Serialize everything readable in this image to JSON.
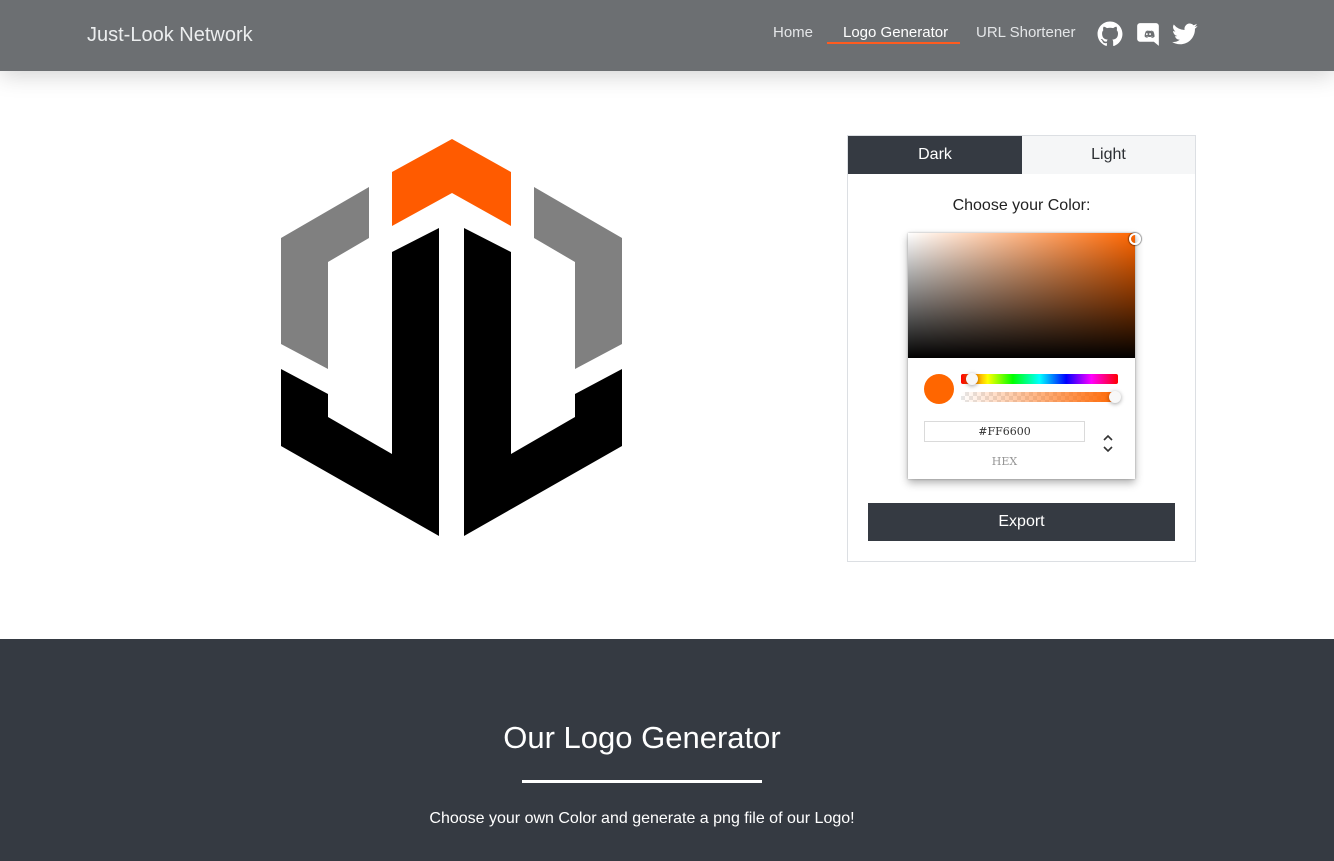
{
  "header": {
    "brand": "Just-Look Network",
    "nav": [
      {
        "label": "Home",
        "active": false
      },
      {
        "label": "Logo Generator",
        "active": true
      },
      {
        "label": "URL Shortener",
        "active": false
      }
    ],
    "social_icons": [
      "github-icon",
      "discord-icon",
      "twitter-icon"
    ],
    "accent_color": "#ff5b1f"
  },
  "logo": {
    "accent_color": "#ff5b1f",
    "side_color": "#808080",
    "base_color": "#000000"
  },
  "panel": {
    "tabs": [
      {
        "label": "Dark",
        "selected": true
      },
      {
        "label": "Light",
        "selected": false
      }
    ],
    "choose_label": "Choose your Color:",
    "color_picker": {
      "hex_value": "#FF6600",
      "format_label": "HEX",
      "hue_degrees": 24,
      "alpha_fraction": 1.0
    },
    "export_label": "Export"
  },
  "footer": {
    "title": "Our Logo Generator",
    "text": "Choose your own Color and generate a png file of our Logo!"
  },
  "colors": {
    "header_bg": "#6c6f72",
    "dark": "#353a42",
    "selected_color": "#FF6600"
  }
}
